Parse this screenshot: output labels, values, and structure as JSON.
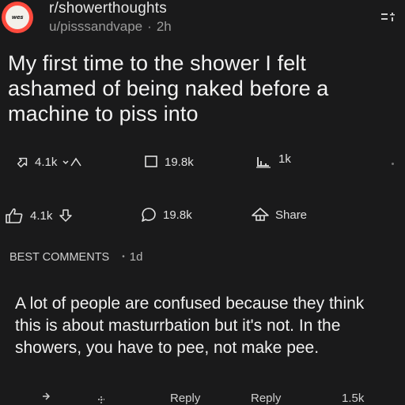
{
  "header": {
    "avatar_text": "wes",
    "subreddit": "r/showerthoughts",
    "author": "u/pisssandvape",
    "separator": "·",
    "age": "2h"
  },
  "post": {
    "title": "My first time to the shower I felt ashamed of being naked before a machine to piss into"
  },
  "actions_top": {
    "votes": "4.1k",
    "comments": "19.8k",
    "awards": "1k"
  },
  "actions": {
    "votes": "4.1k",
    "comments": "19.8k",
    "share_label": "Share"
  },
  "comments_section": {
    "header": "BEST COMMENTS",
    "separator": "•",
    "age": "1d"
  },
  "top_comment": {
    "text": "A lot of people are confused because they think this is about masturrbation but it's not. In the showers, you have to pee, not make pee.",
    "reply_label_1": "Reply",
    "reply_label_2": "Reply",
    "count": "1.5k"
  },
  "colors": {
    "background": "#1a1a1b",
    "avatar_ring": "#ff4a3d",
    "text": "#f2f2f2",
    "muted": "#9a9a9a"
  }
}
